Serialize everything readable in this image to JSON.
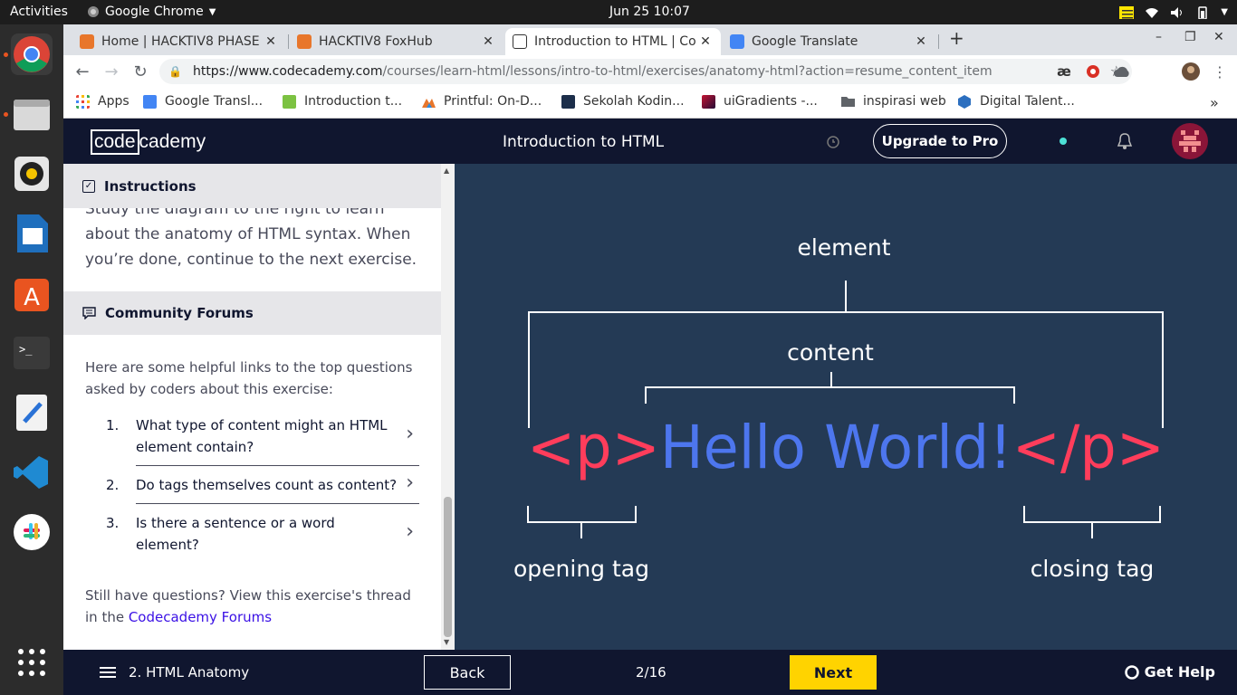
{
  "topbar": {
    "activities": "Activities",
    "app_name": "Google Chrome",
    "clock": "Jun 25  10:07"
  },
  "dock": {
    "items": [
      "chrome-icon",
      "files-icon",
      "rhythmbox-icon",
      "writer-icon",
      "software-icon",
      "terminal-icon",
      "text-editor-icon",
      "vscode-icon",
      "slack-icon",
      "show-apps-icon"
    ]
  },
  "browser": {
    "tabs": [
      {
        "title": "Home | HACKTIV8 PHASE"
      },
      {
        "title": "HACKTIV8 FoxHub"
      },
      {
        "title": "Introduction to HTML | Co"
      },
      {
        "title": "Google Translate"
      }
    ],
    "url_host": "https://www.codecademy.com",
    "url_path": "/courses/learn-html/lessons/intro-to-html/exercises/anatomy-html?action=resume_content_item",
    "bookmarks": [
      "Apps",
      "Google Transl...",
      "Introduction t...",
      "Printful: On-D...",
      "Sekolah Kodin...",
      "uiGradients -...",
      "inspirasi web",
      "Digital Talent..."
    ]
  },
  "header": {
    "logo_a": "code",
    "logo_b": "cademy",
    "title": "Introduction to HTML",
    "upgrade": "Upgrade to Pro"
  },
  "panel": {
    "instructions_label": "Instructions",
    "instructions_text": "Study the diagram to the right to learn about the anatomy of HTML syntax. When you’re done, continue to the next exercise.",
    "forums_label": "Community Forums",
    "help_intro": "Here are some helpful links to the top questions asked by coders about this exercise:",
    "questions": [
      {
        "num": "1.",
        "text": "What type of content might an HTML element contain?"
      },
      {
        "num": "2.",
        "text": "Do tags themselves count as content?"
      },
      {
        "num": "3.",
        "text": "Is there a sentence or a word element?"
      }
    ],
    "still_text": "Still have questions? View this exercise's thread in the ",
    "still_link": "Codecademy Forums"
  },
  "diagram": {
    "element_label": "element",
    "content_label": "content",
    "open_tag": "<p>",
    "content": "Hello World!",
    "close_tag": "</p>",
    "opening_label": "opening tag",
    "closing_label": "closing tag",
    "tag_color": "#ff3d5b",
    "content_color": "#4d76ee"
  },
  "footer": {
    "lesson": "2. HTML Anatomy",
    "back": "Back",
    "progress": "2/16",
    "next": "Next",
    "help": "Get Help"
  }
}
